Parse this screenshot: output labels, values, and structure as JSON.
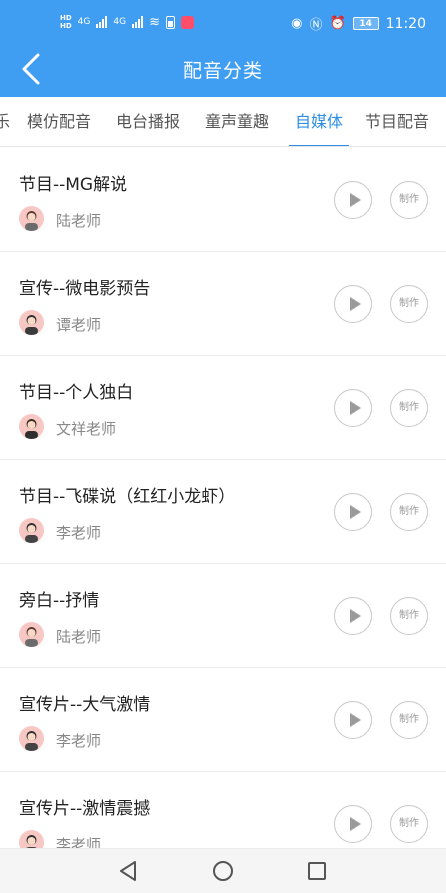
{
  "status_bar": {
    "time": "11:20",
    "battery_level": "14",
    "network_type_1": "4G",
    "network_type_2": "4G"
  },
  "header": {
    "title": "配音分类"
  },
  "tabs": [
    {
      "label": "乐"
    },
    {
      "label": "模仿配音"
    },
    {
      "label": "电台播报"
    },
    {
      "label": "童声童趣"
    },
    {
      "label": "自媒体",
      "active": true
    },
    {
      "label": "节目配音"
    }
  ],
  "items": [
    {
      "title": "节目--MG解说",
      "teacher": "陆老师",
      "make_label": "制作"
    },
    {
      "title": "宣传--微电影预告",
      "teacher": "谭老师",
      "make_label": "制作"
    },
    {
      "title": "节目--个人独白",
      "teacher": "文祥老师",
      "make_label": "制作"
    },
    {
      "title": "节目--飞碟说（红红小龙虾）",
      "teacher": "李老师",
      "make_label": "制作"
    },
    {
      "title": "旁白--抒情",
      "teacher": "陆老师",
      "make_label": "制作"
    },
    {
      "title": "宣传片--大气激情",
      "teacher": "李老师",
      "make_label": "制作"
    },
    {
      "title": "宣传片--激情震撼",
      "teacher": "李老师",
      "make_label": "制作"
    }
  ],
  "colors": {
    "header_bg": "#3f9df2",
    "active_tab": "#2d8de6",
    "avatar_bg": "#f7c7c3"
  }
}
